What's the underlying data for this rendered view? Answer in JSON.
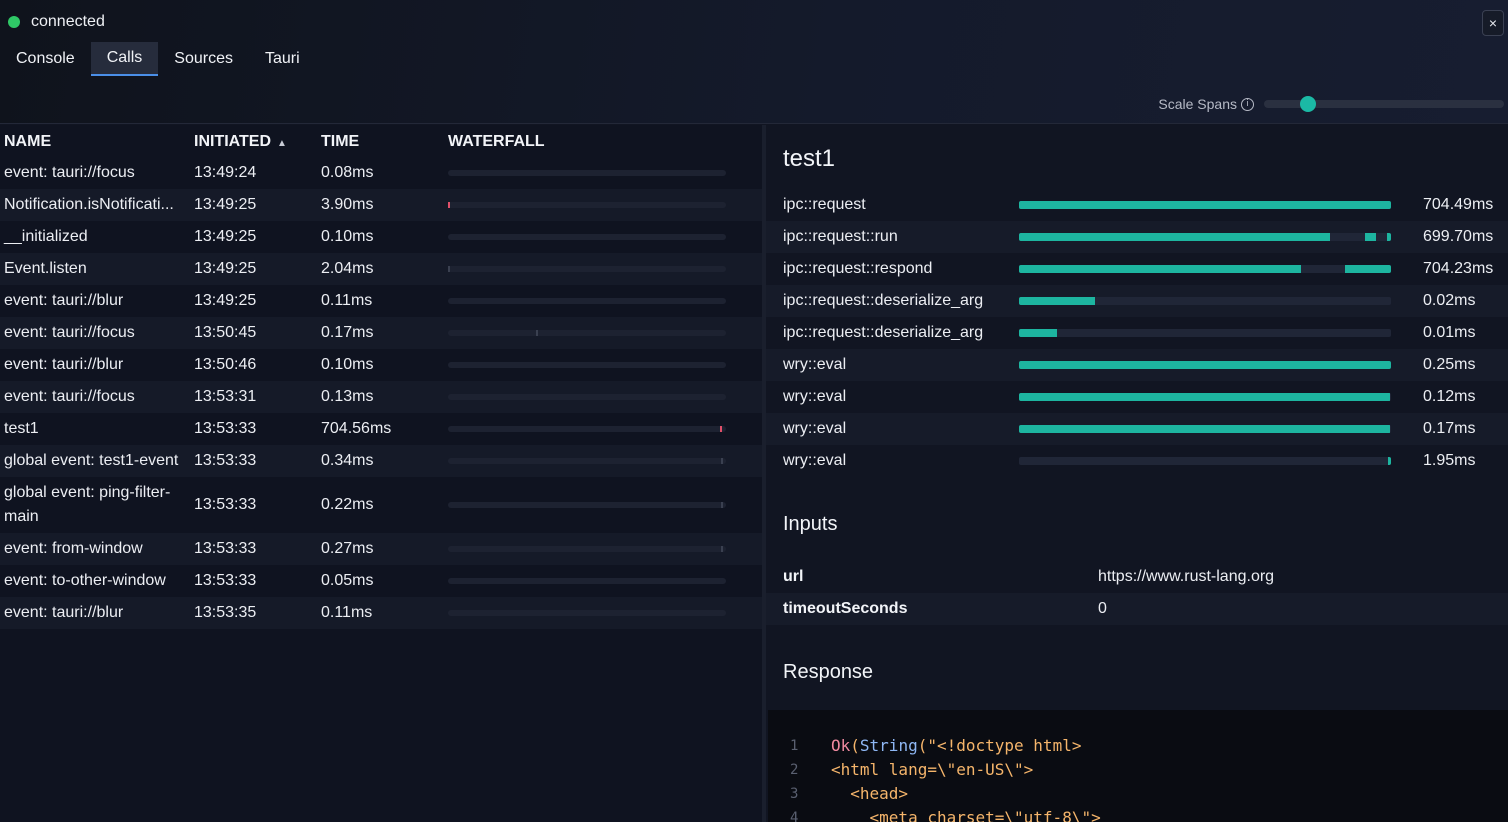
{
  "status": {
    "text": "connected",
    "color": "#2fc866"
  },
  "tabs": [
    {
      "label": "Console",
      "active": false
    },
    {
      "label": "Calls",
      "active": true
    },
    {
      "label": "Sources",
      "active": false
    },
    {
      "label": "Tauri",
      "active": false
    }
  ],
  "close_icon": "×",
  "scale_spans": {
    "label": "Scale Spans",
    "info_icon": "i",
    "value": 0.1
  },
  "calls_table": {
    "headers": {
      "name": "NAME",
      "initiated": "INITIATED",
      "sort_icon": "▲",
      "time": "TIME",
      "waterfall": "WATERFALL"
    },
    "rows": [
      {
        "name": "event: tauri://focus",
        "initiated": "13:49:24",
        "time": "0.08ms",
        "wf": null
      },
      {
        "name": "Notification.isNotificati...",
        "initiated": "13:49:25",
        "time": "3.90ms",
        "wf": {
          "at": 0.0,
          "color": "#e0506a"
        }
      },
      {
        "name": "__initialized",
        "initiated": "13:49:25",
        "time": "0.10ms",
        "wf": null
      },
      {
        "name": "Event.listen",
        "initiated": "13:49:25",
        "time": "2.04ms",
        "wf": {
          "at": 0.0,
          "color": "#3a4050"
        }
      },
      {
        "name": "event: tauri://blur",
        "initiated": "13:49:25",
        "time": "0.11ms",
        "wf": null
      },
      {
        "name": "event: tauri://focus",
        "initiated": "13:50:45",
        "time": "0.17ms",
        "wf": {
          "at": 0.32,
          "color": "#3a4050"
        }
      },
      {
        "name": "event: tauri://blur",
        "initiated": "13:50:46",
        "time": "0.10ms",
        "wf": null
      },
      {
        "name": "event: tauri://focus",
        "initiated": "13:53:31",
        "time": "0.13ms",
        "wf": null
      },
      {
        "name": "test1",
        "initiated": "13:53:33",
        "time": "704.56ms",
        "wf": {
          "at": 0.985,
          "color": "#e0506a"
        }
      },
      {
        "name": "global event: test1-event",
        "initiated": "13:53:33",
        "time": "0.34ms",
        "wf": {
          "at": 0.988,
          "color": "#3a4050"
        }
      },
      {
        "name": "global event: ping-filter-main",
        "initiated": "13:53:33",
        "time": "0.22ms",
        "wf": {
          "at": 0.988,
          "color": "#3a4050"
        }
      },
      {
        "name": "event: from-window",
        "initiated": "13:53:33",
        "time": "0.27ms",
        "wf": {
          "at": 0.988,
          "color": "#3a4050"
        }
      },
      {
        "name": "event: to-other-window",
        "initiated": "13:53:33",
        "time": "0.05ms",
        "wf": null
      },
      {
        "name": "event: tauri://blur",
        "initiated": "13:53:35",
        "time": "0.11ms",
        "wf": null
      }
    ]
  },
  "detail": {
    "title": "test1",
    "spans": [
      {
        "name": "ipc::request",
        "value": "704.49ms",
        "segments": [
          [
            0.0,
            1.0
          ]
        ]
      },
      {
        "name": "ipc::request::run",
        "value": "699.70ms",
        "segments": [
          [
            0.0,
            0.835
          ],
          [
            0.93,
            0.96
          ],
          [
            0.99,
            1.0
          ]
        ]
      },
      {
        "name": "ipc::request::respond",
        "value": "704.23ms",
        "segments": [
          [
            0.0,
            0.758
          ],
          [
            0.875,
            1.0
          ]
        ]
      },
      {
        "name": "ipc::request::deserialize_arg",
        "value": "0.02ms",
        "segments": [
          [
            0.0,
            0.205
          ]
        ]
      },
      {
        "name": "ipc::request::deserialize_arg",
        "value": "0.01ms",
        "segments": [
          [
            0.0,
            0.102
          ]
        ]
      },
      {
        "name": "wry::eval",
        "value": "0.25ms",
        "segments": [
          [
            0.0,
            1.0
          ]
        ]
      },
      {
        "name": "wry::eval",
        "value": "0.12ms",
        "segments": [
          [
            0.0,
            0.997
          ]
        ]
      },
      {
        "name": "wry::eval",
        "value": "0.17ms",
        "segments": [
          [
            0.0,
            0.997
          ]
        ]
      },
      {
        "name": "wry::eval",
        "value": "1.95ms",
        "segments": [
          [
            0.993,
            1.0
          ]
        ]
      }
    ],
    "inputs_title": "Inputs",
    "inputs": [
      {
        "key": "url",
        "value": "https://www.rust-lang.org"
      },
      {
        "key": "timeoutSeconds",
        "value": "0"
      }
    ],
    "response_title": "Response",
    "code_lines": [
      {
        "n": "1",
        "fn": "Ok",
        "p1": "(",
        "type": "String",
        "rest": "(\"<!doctype html>"
      },
      {
        "n": "2",
        "fn": "",
        "p1": "",
        "type": "",
        "rest": "<html lang=\\\"en-US\\\">"
      },
      {
        "n": "3",
        "fn": "",
        "p1": "",
        "type": "",
        "rest": "  <head>"
      },
      {
        "n": "4",
        "fn": "",
        "p1": "",
        "type": "",
        "rest": "    <meta charset=\\\"utf-8\\\">"
      }
    ]
  },
  "colors": {
    "accent": "#1db5a0",
    "error_mark": "#e0506a",
    "tab_underline": "#4b8fe8"
  }
}
